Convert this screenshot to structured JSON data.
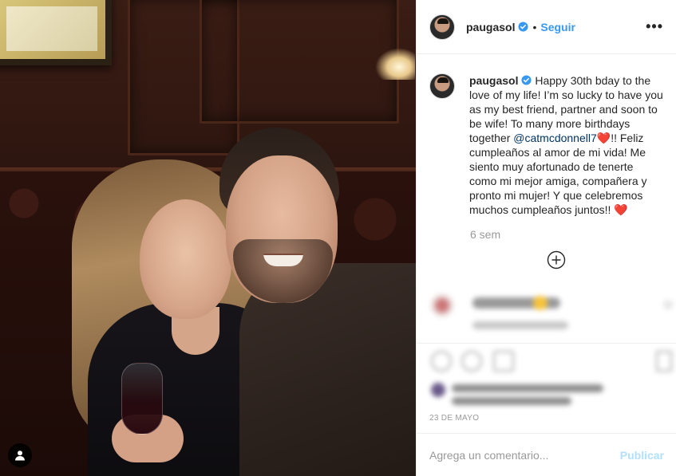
{
  "post": {
    "username": "paugasol",
    "follow_label": "Seguir",
    "separator": "•",
    "more_label": "•••"
  },
  "caption": {
    "username": "paugasol",
    "text_part1": "Happy 30th bday to the love of my life! I’m so lucky to have you as my best friend, partner and soon to be wife! To many more birthdays together ",
    "mention": "@catmcdonnell7",
    "heart1": "❤️",
    "text_part2": "!! Feliz cumpleaños al amor de mi vida! Me siento muy afortunado de tenerte como mi mejor amiga, compañera y pronto mi mujer! Y que celebremos muchos cumpleaños juntos!! ",
    "heart2": "❤️",
    "time": "6 sem"
  },
  "footer": {
    "date": "23 DE MAYO",
    "comment_placeholder": "Agrega un comentario...",
    "publish_label": "Publicar"
  },
  "icons": {
    "verified": "verified-badge-icon",
    "load_more": "plus-circle-icon",
    "tag": "user-tag-icon"
  },
  "colors": {
    "accent": "#3897f0",
    "publish_disabled": "#b2dffc",
    "heart": "#ed4956",
    "muted": "#999999"
  }
}
